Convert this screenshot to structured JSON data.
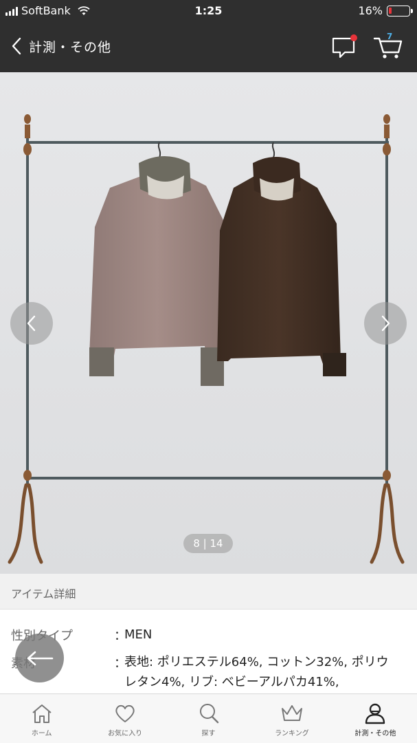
{
  "status_bar": {
    "carrier": "SoftBank",
    "time": "1:25",
    "battery_percent": "16%",
    "battery_level": 0.16,
    "battery_color": "#e8333a"
  },
  "nav": {
    "title": "計測・その他",
    "cart_count": "7",
    "has_unread_message": true,
    "notification_color": "#e8333a",
    "badge_color": "#4fb0e6"
  },
  "gallery": {
    "page_indicator": "8 | 14",
    "current": 8,
    "total": 14
  },
  "detail": {
    "section_title": "アイテム詳細",
    "rows": [
      {
        "label": "性別タイプ",
        "colon": "：",
        "value": "MEN"
      },
      {
        "label": "素材",
        "colon": "：",
        "value": "表地: ポリエステル64%, コットン32%, ポリウレタン4%, リブ: ベビーアルパカ41%,"
      }
    ]
  },
  "tabbar": {
    "items": [
      {
        "label": "ホーム",
        "icon": "home-icon"
      },
      {
        "label": "お気に入り",
        "icon": "heart-icon"
      },
      {
        "label": "探す",
        "icon": "search-icon"
      },
      {
        "label": "ランキング",
        "icon": "crown-icon"
      },
      {
        "label": "計測・その他",
        "icon": "user-icon",
        "active": true
      }
    ]
  }
}
